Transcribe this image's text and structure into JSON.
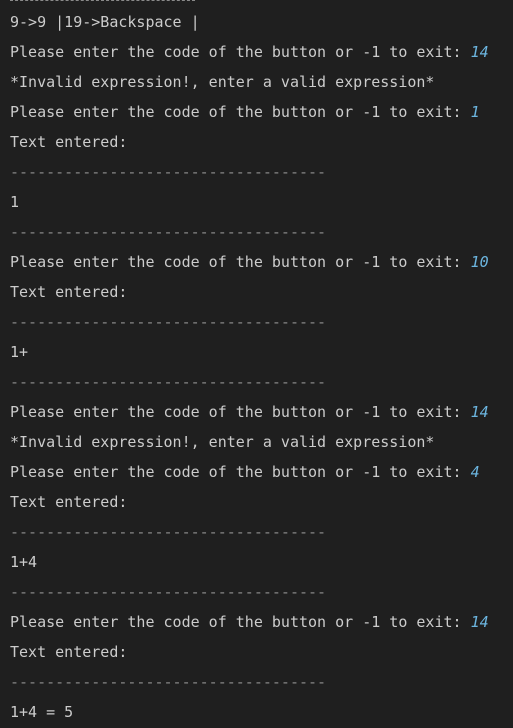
{
  "colors": {
    "background": "#1f1f1f",
    "text": "#cccccc",
    "input": "#6cb6e0",
    "separator": "#8a8a8a"
  },
  "terminal": {
    "lines": [
      {
        "kind": "text",
        "text": "9->9 |19->Backspace |"
      },
      {
        "kind": "prompt",
        "text": "Please enter the code of the button or -1 to exit: ",
        "input": "14"
      },
      {
        "kind": "text",
        "text": "*Invalid expression!, enter a valid expression*"
      },
      {
        "kind": "prompt",
        "text": "Please enter the code of the button or -1 to exit: ",
        "input": "1"
      },
      {
        "kind": "text",
        "text": "Text entered:"
      },
      {
        "kind": "separator",
        "text": "-----------------------------------"
      },
      {
        "kind": "text",
        "text": "1"
      },
      {
        "kind": "separator",
        "text": "-----------------------------------"
      },
      {
        "kind": "prompt",
        "text": "Please enter the code of the button or -1 to exit: ",
        "input": "10"
      },
      {
        "kind": "text",
        "text": "Text entered:"
      },
      {
        "kind": "separator",
        "text": "-----------------------------------"
      },
      {
        "kind": "text",
        "text": "1+"
      },
      {
        "kind": "separator",
        "text": "-----------------------------------"
      },
      {
        "kind": "prompt",
        "text": "Please enter the code of the button or -1 to exit: ",
        "input": "14"
      },
      {
        "kind": "text",
        "text": "*Invalid expression!, enter a valid expression*"
      },
      {
        "kind": "prompt",
        "text": "Please enter the code of the button or -1 to exit: ",
        "input": "4"
      },
      {
        "kind": "text",
        "text": "Text entered:"
      },
      {
        "kind": "separator",
        "text": "-----------------------------------"
      },
      {
        "kind": "text",
        "text": "1+4"
      },
      {
        "kind": "separator",
        "text": "-----------------------------------"
      },
      {
        "kind": "prompt",
        "text": "Please enter the code of the button or -1 to exit: ",
        "input": "14"
      },
      {
        "kind": "text",
        "text": "Text entered:"
      },
      {
        "kind": "separator",
        "text": "-----------------------------------"
      },
      {
        "kind": "text",
        "text": "1+4 = 5"
      }
    ]
  }
}
